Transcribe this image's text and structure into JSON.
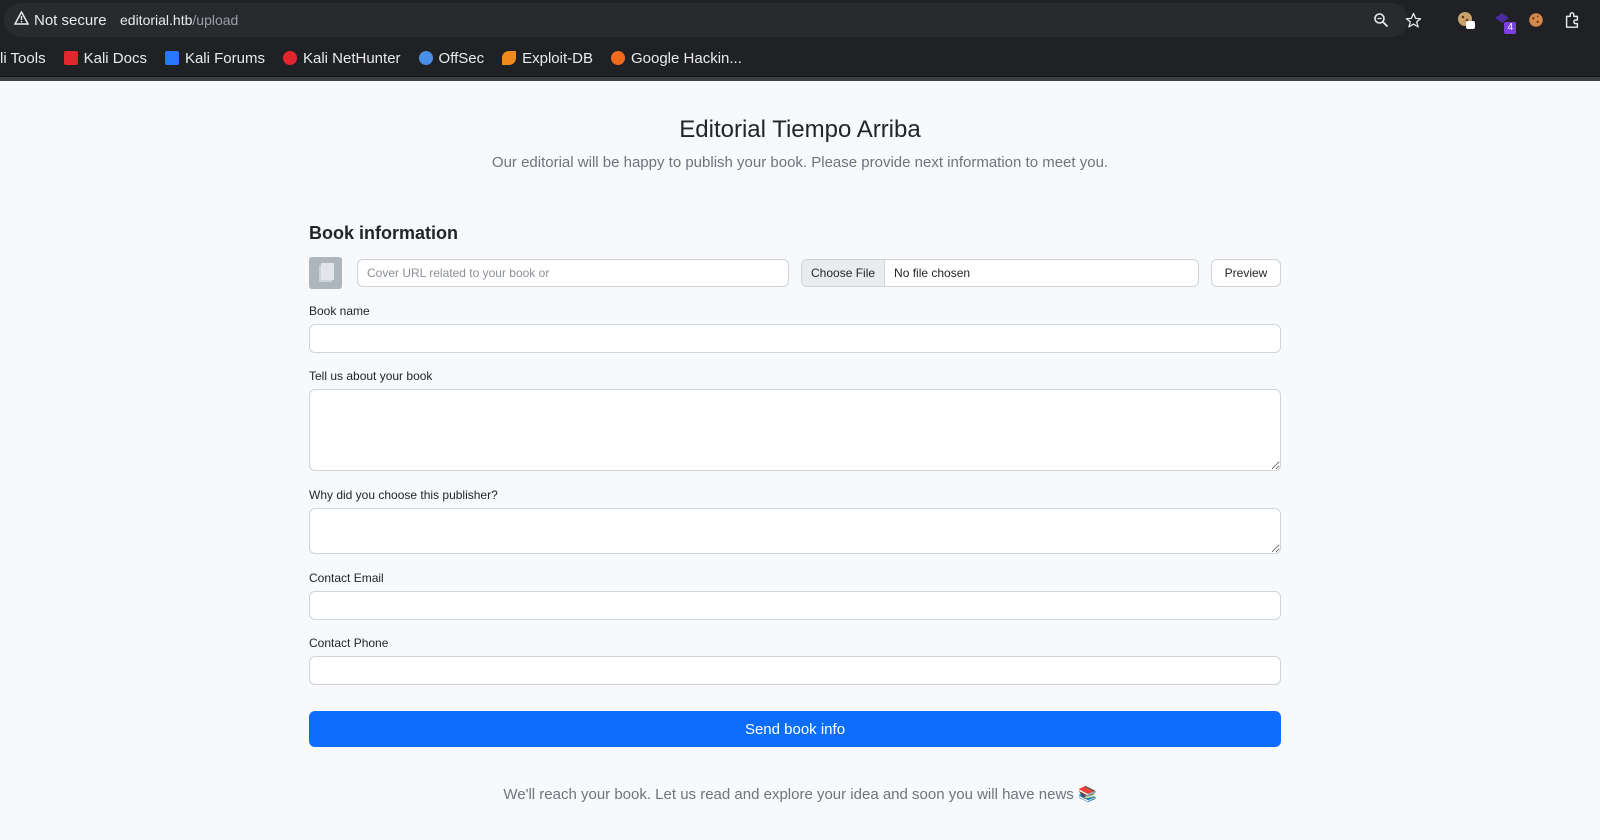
{
  "browser": {
    "security_label": "Not secure",
    "url_host": "editorial.htb",
    "url_path": "/upload",
    "extension_badge": "4",
    "bookmarks": [
      {
        "label": "li Tools",
        "icon": "kali-tools-icon",
        "color": "#367bf0"
      },
      {
        "label": "Kali Docs",
        "icon": "kali-docs-icon",
        "color": "#e1262d"
      },
      {
        "label": "Kali Forums",
        "icon": "kali-forums-icon",
        "color": "#2777ff"
      },
      {
        "label": "Kali NetHunter",
        "icon": "kali-nethunter-icon",
        "color": "#e1262d"
      },
      {
        "label": "OffSec",
        "icon": "offsec-icon",
        "color": "#4a8fe7"
      },
      {
        "label": "Exploit-DB",
        "icon": "exploit-db-icon",
        "color": "#ef8a1c"
      },
      {
        "label": "Google Hackin...",
        "icon": "ghdb-icon",
        "color": "#ef6a1c"
      }
    ]
  },
  "page": {
    "title": "Editorial Tiempo Arriba",
    "lead": "Our editorial will be happy to publish your book. Please provide next information to meet you.",
    "section_title": "Book information",
    "cover_url_placeholder": "Cover URL related to your book or",
    "file_button": "Choose File",
    "file_status": "No file chosen",
    "preview_button": "Preview",
    "book_name_label": "Book name",
    "about_label": "Tell us about your book",
    "why_label": "Why did you choose this publisher?",
    "email_label": "Contact Email",
    "phone_label": "Contact Phone",
    "submit_button": "Send book info",
    "footer": "We'll reach your book. Let us read and explore your idea and soon you will have news 📚"
  },
  "colors": {
    "primary": "#0d6efd",
    "muted": "#6c757d",
    "background": "#f8f9fa"
  }
}
